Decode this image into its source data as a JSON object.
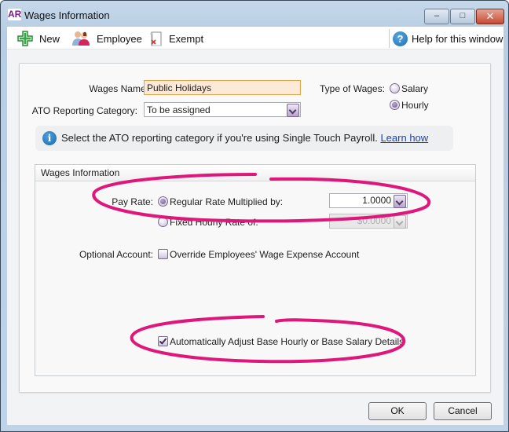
{
  "window": {
    "app_badge": "AR",
    "title": "Wages Information",
    "controls": {
      "minimize": "–",
      "maximize": "□",
      "close": "✕"
    }
  },
  "toolbar": {
    "new_label": "New",
    "employee_label": "Employee",
    "exempt_label": "Exempt",
    "help_label": "Help for this window",
    "help_glyph": "?"
  },
  "form": {
    "wages_name_label": "Wages Name:",
    "wages_name_value": "Public Holidays",
    "ato_label": "ATO Reporting Category:",
    "ato_value": "To be assigned",
    "type_label": "Type of Wages:",
    "type_options": [
      {
        "label": "Salary",
        "selected": false
      },
      {
        "label": "Hourly",
        "selected": true
      }
    ]
  },
  "info_bar": {
    "icon_glyph": "i",
    "text": "Select the ATO reporting category if you're using Single Touch Payroll.",
    "link_text": "Learn how"
  },
  "wages_info": {
    "title": "Wages Information",
    "pay_rate_label": "Pay Rate:",
    "regular_rate_label": "Regular Rate Multiplied by:",
    "regular_rate_selected": true,
    "regular_rate_value": "1.0000",
    "fixed_rate_label": "Fixed Hourly Rate of:",
    "fixed_rate_selected": false,
    "fixed_rate_value": "$0.0000",
    "optional_account_label": "Optional Account:",
    "override_label": "Override Employees' Wage Expense Account",
    "override_checked": false,
    "auto_adjust_label": "Automatically Adjust Base Hourly or Base Salary Details",
    "auto_adjust_checked": true
  },
  "buttons": {
    "ok": "OK",
    "cancel": "Cancel"
  },
  "annotation_color": "#e0177a"
}
